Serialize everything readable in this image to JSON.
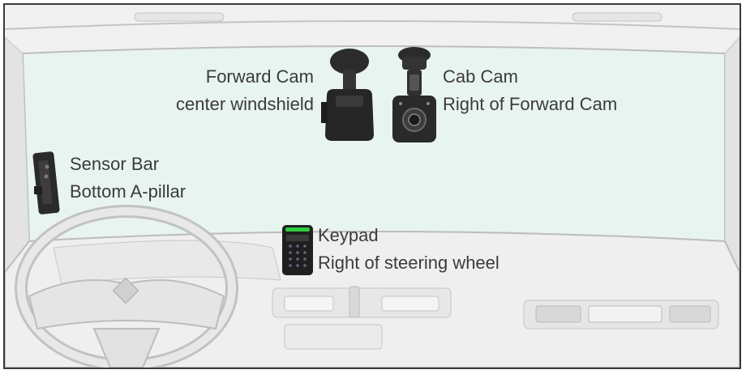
{
  "colors": {
    "frame_border": "#3a3a3a",
    "windshield": "#e8f4ef",
    "cab_interior": "#f1f1f1",
    "line": "#b9b9b9",
    "text": "#3b3b3b",
    "device_dark": "#2a2a2a",
    "keypad_indicator": "#2ecc40"
  },
  "devices": {
    "forward_cam": {
      "name": "Forward Cam",
      "location": "center windshield",
      "icon": "dash-camera-icon"
    },
    "cab_cam": {
      "name": "Cab Cam",
      "location": "Right of Forward Cam",
      "icon": "cab-camera-icon"
    },
    "sensor_bar": {
      "name": "Sensor Bar",
      "location": "Bottom A-pillar",
      "icon": "sensor-bar-icon"
    },
    "keypad": {
      "name": "Keypad",
      "location": "Right of steering wheel",
      "icon": "keypad-icon"
    }
  }
}
